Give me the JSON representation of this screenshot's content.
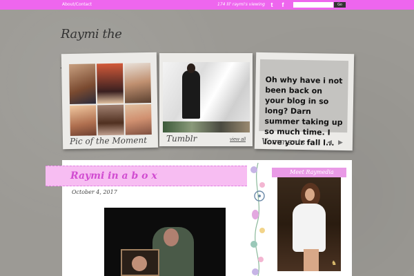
{
  "topbar": {
    "about_contact": "About/Contact",
    "viewing": "174 lil' raymi's viewing",
    "twitter_icon": "t",
    "facebook_icon": "f",
    "search_placeholder": "",
    "go_label": "Go"
  },
  "logo": {
    "text": "Raymi the Minx"
  },
  "cards": {
    "pic_of_moment": "Pic of the Moment",
    "tumblr": "Tumblr",
    "view_all": "view all",
    "vomments": "Vomments",
    "vomment_text": "Oh why have i not been back on your blog in so long? Darn summer taking up so much time. I love your fall l...",
    "arrow_left": "◀",
    "arrow_right": "▶"
  },
  "post": {
    "title": "Raymi in a b o x",
    "date": "October 4, 2017"
  },
  "sidebar": {
    "title": "Meet Raymedia",
    "badge_icon": "♞"
  },
  "colors": {
    "topbar": "#ee66ee",
    "ribbon": "#f7bdf2",
    "ribbon_title": "#d14cd1"
  }
}
